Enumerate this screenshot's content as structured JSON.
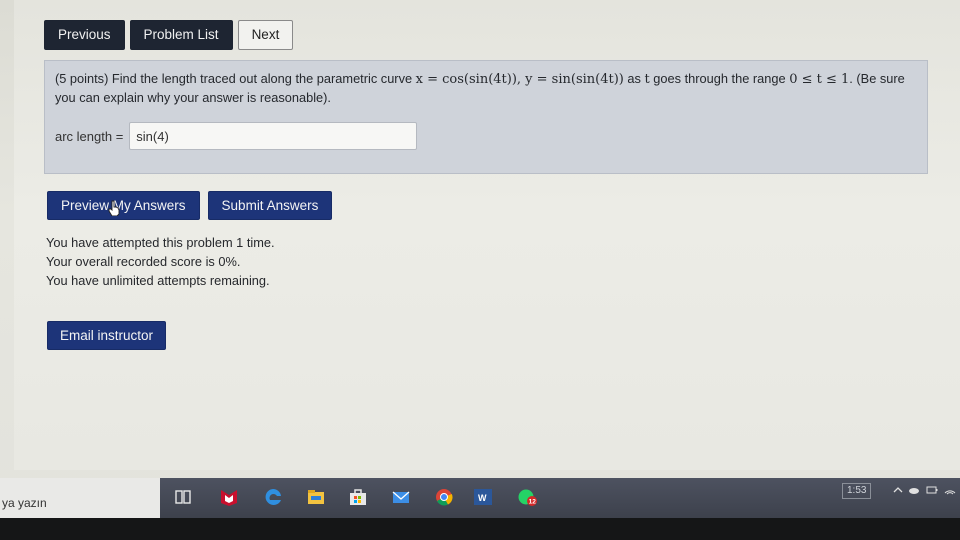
{
  "nav": {
    "previous": "Previous",
    "problem_list": "Problem List",
    "next": "Next"
  },
  "problem": {
    "intro": "(5 points) Find the length traced out along the parametric curve ",
    "x_eq": "x = cos(sin(4t)), y = sin(sin(4t))",
    "mid": " as ",
    "t_var": "t",
    "range_text": " goes through the range ",
    "range": "0 ≤ t ≤ 1",
    "outro": ". (Be sure you can explain why your answer is reasonable).",
    "answer_label": "arc length =",
    "answer_value": "sin(4)"
  },
  "actions": {
    "preview": "Preview My Answers",
    "submit": "Submit Answers"
  },
  "status": {
    "line1": "You have attempted this problem 1 time.",
    "line2": "Your overall recorded score is 0%.",
    "line3": "You have unlimited attempts remaining."
  },
  "email": "Email instructor",
  "taskbar": {
    "search_text": "ya yazın",
    "clock": "1:53",
    "word_label": "W",
    "badge": "12",
    "icons": [
      "task-view-icon",
      "mcafee-icon",
      "edge-icon",
      "file-explorer-icon",
      "store-icon",
      "mail-icon",
      "chrome-icon",
      "word-icon",
      "whatsapp-icon"
    ]
  },
  "colors": {
    "nav_button": "#1e2532",
    "action_button": "#1d3479",
    "problem_box": "#cfd3da",
    "page_bg": "#e8e8e2"
  }
}
